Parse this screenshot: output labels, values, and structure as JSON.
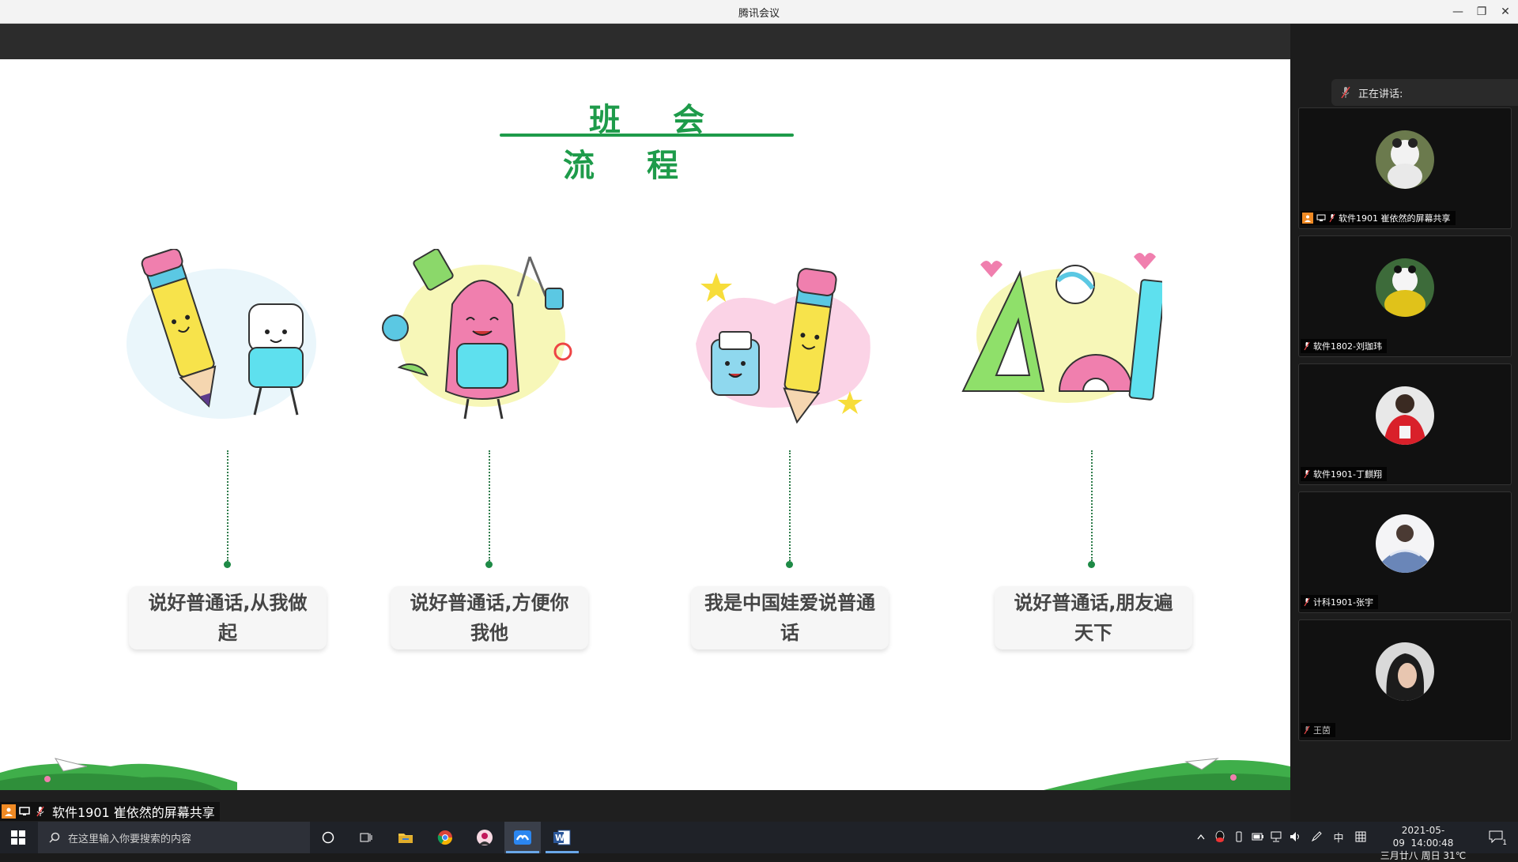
{
  "window": {
    "title": "腾讯会议",
    "minimize": "—",
    "restore": "❐",
    "close": "✕"
  },
  "slide": {
    "title": "班会流程",
    "steps": [
      {
        "text": "说好普通话,从我做起",
        "illustration": "pencil-and-eraser"
      },
      {
        "text": "说好普通话,方便你我他",
        "illustration": "backpack-with-supplies"
      },
      {
        "text": "我是中国娃爱说普通话",
        "illustration": "sharpener-and-pencil"
      },
      {
        "text": "说好普通话,朋友遍天下",
        "illustration": "triangle-protractor-ruler"
      }
    ]
  },
  "share_label": {
    "text": "软件1901 崔依然的屏幕共享"
  },
  "right_panel": {
    "speaking_label": "正在讲话:",
    "participants": [
      {
        "name": "软件1901 崔依然的屏幕共享",
        "sharing": true
      },
      {
        "name": "软件1802-刘珈玮",
        "sharing": false
      },
      {
        "name": "软件1901-丁麒翔",
        "sharing": false
      },
      {
        "name": "计科1901-张宇",
        "sharing": false
      },
      {
        "name": "王茵",
        "sharing": false
      }
    ]
  },
  "taskbar": {
    "search_placeholder": "在这里输入你要搜索的内容",
    "apps": [
      "cortana-icon",
      "task-view-icon",
      "file-explorer-icon",
      "chrome-icon",
      "app-avatar-icon",
      "tencent-meeting-icon",
      "word-icon"
    ],
    "tray": {
      "ime": "中",
      "date": "2021-05-09",
      "time": "14:00:48",
      "lunar": "三月廿八 周日 31℃",
      "notifications": "1"
    }
  }
}
